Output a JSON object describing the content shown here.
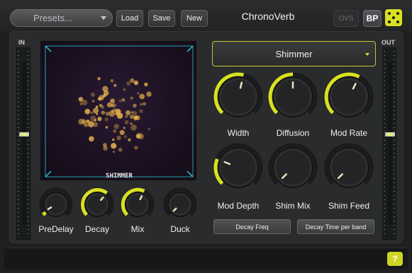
{
  "toolbar": {
    "presets_label": "Presets...",
    "load_label": "Load",
    "save_label": "Save",
    "new_label": "New",
    "title": "ChronoVerb",
    "ovs_label": "OVS",
    "bp_label": "BP",
    "dice_icon": "dice-icon"
  },
  "meters": {
    "in_label": "IN",
    "out_label": "OUT",
    "in_level": 0.57,
    "out_level": 0.57
  },
  "visualizer": {
    "label": "SHIMMER",
    "accent": "#e3b04b",
    "corner_color": "#29c6d8"
  },
  "algorithm": {
    "selected": "Shimmer"
  },
  "knobs": [
    {
      "name": "width-knob",
      "label": "Width",
      "value": 0.55
    },
    {
      "name": "diffusion-knob",
      "label": "Diffusion",
      "value": 0.5
    },
    {
      "name": "mod-rate-knob",
      "label": "Mod Rate",
      "value": 0.6
    },
    {
      "name": "mod-depth-knob",
      "label": "Mod Depth",
      "value": 0.25
    },
    {
      "name": "shim-mix-knob",
      "label": "Shim Mix",
      "value": 0.0
    },
    {
      "name": "shim-feed-knob",
      "label": "Shim Feed",
      "value": 0.0
    }
  ],
  "small_knobs": [
    {
      "name": "predelay-knob",
      "label": "PreDelay",
      "value": 0.05
    },
    {
      "name": "decay-knob",
      "label": "Decay",
      "value": 0.65
    },
    {
      "name": "mix-knob",
      "label": "Mix",
      "value": 0.6
    },
    {
      "name": "duck-knob",
      "label": "Duck",
      "value": 0.0
    }
  ],
  "buttons": {
    "decay_freq": "Decay Freq",
    "decay_time_per_band": "Decay Time per band"
  },
  "help_label": "?",
  "colors": {
    "accent": "#d9e021",
    "background": "#1e1f20"
  }
}
